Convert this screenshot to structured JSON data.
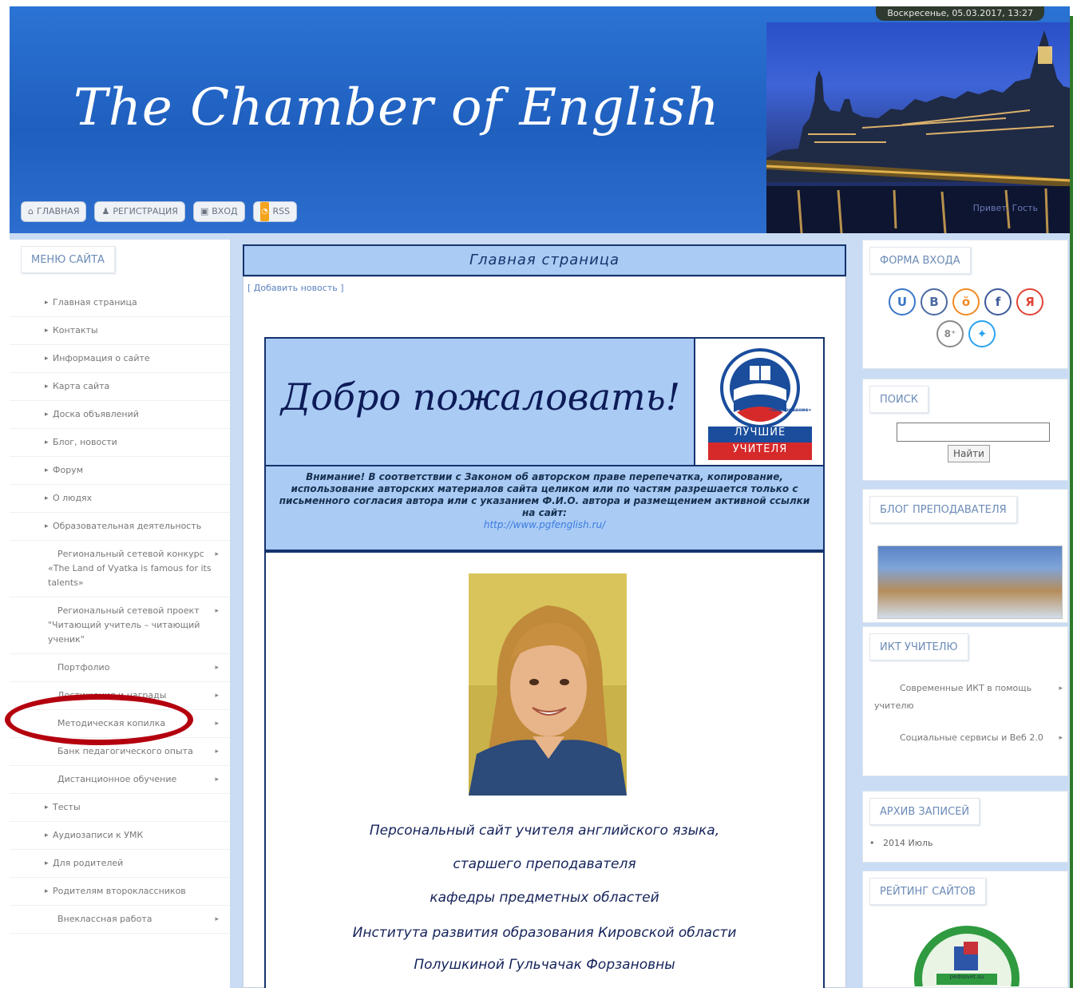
{
  "header": {
    "datetime": "Воскресенье, 05.03.2017, 13:27",
    "site_title": "The Chamber of English",
    "hello_text": "Привет, Гость",
    "nav": [
      {
        "icon": "home-icon",
        "label": "ГЛАВНАЯ"
      },
      {
        "icon": "user-icon",
        "label": "РЕГИСТРАЦИЯ"
      },
      {
        "icon": "lock-icon",
        "label": "ВХОД"
      },
      {
        "icon": "rss-icon",
        "label": "RSS"
      }
    ]
  },
  "left_menu": {
    "title": "МЕНЮ САЙТА",
    "items": [
      "Главная страница",
      "Контакты",
      "Информация о сайте",
      "Карта сайта",
      "Доска объявлений",
      "Блог, новости",
      "Форум",
      "О людях",
      "Образовательная деятельность",
      "Региональный сетевой конкурс «The Land of Vyatka is famous for its talents»",
      "Региональный сетевой проект \"Читающий учитель – читающий ученик\"",
      "Портфолио",
      "Достижения и награды",
      "Методическая копилка",
      "Банк педагогического опыта",
      "Дистанционное обучение",
      "Тесты",
      "Аудиозаписи к УМК",
      "Для родителей",
      "Родителям второклассников",
      "Внеклассная работа"
    ]
  },
  "center": {
    "title": "Главная страница",
    "add_news": "[ Добавить новость ]",
    "welcome": "Добро пожаловать!",
    "badge_line1": "ЛУЧШИЕ",
    "badge_line2": "УЧИТЕЛЯ",
    "badge_small": "«Образование»",
    "notice": "Внимание! В соответствии с Законом об авторском праве перепечатка, копирование, использование авторских материалов сайта целиком или по частям разрешается только с письменного согласия автора или с указанием Ф.И.О. автора и размещением активной ссылки на сайт:",
    "notice_link": "http://www.pgfenglish.ru/",
    "lines": [
      "Персональный сайт учителя английского языка,",
      "старшего преподавателя",
      "кафедры предметных областей",
      "Института развития образования Кировской области",
      "Полушкиной Гульчачак Форзановны"
    ]
  },
  "right": {
    "login_title": "ФОРМА ВХОДА",
    "social": [
      {
        "icon": "u-icon",
        "label": "U",
        "color": "#3a76c8"
      },
      {
        "icon": "vk-icon",
        "label": "B",
        "color": "#4a6aa0"
      },
      {
        "icon": "odnoklassniki-icon",
        "label": "ŏ",
        "color": "#f08a24"
      },
      {
        "icon": "facebook-icon",
        "label": "f",
        "color": "#3c5a99"
      },
      {
        "icon": "yandex-icon",
        "label": "Я",
        "color": "#e04437"
      },
      {
        "icon": "google-plus-icon",
        "label": "8⁺",
        "color": "#8a8a8a"
      },
      {
        "icon": "twitter-icon",
        "label": "✦",
        "color": "#2aa3ef"
      }
    ],
    "search_title": "ПОИСК",
    "search_button": "Найти",
    "blog_title": "БЛОГ ПРЕПОДАВАТЕЛЯ",
    "ict_title": "ИКТ УЧИТЕЛЮ",
    "ict_items": [
      "Современные ИКТ в помощь учителю",
      "Социальные сервисы и Веб 2.0"
    ],
    "archive_title": "АРХИВ ЗАПИСЕЙ",
    "archive_item": "2014 Июль",
    "rating_title": "РЕЙТИНГ САЙТОВ",
    "rating_label": "pedsovet.su"
  }
}
